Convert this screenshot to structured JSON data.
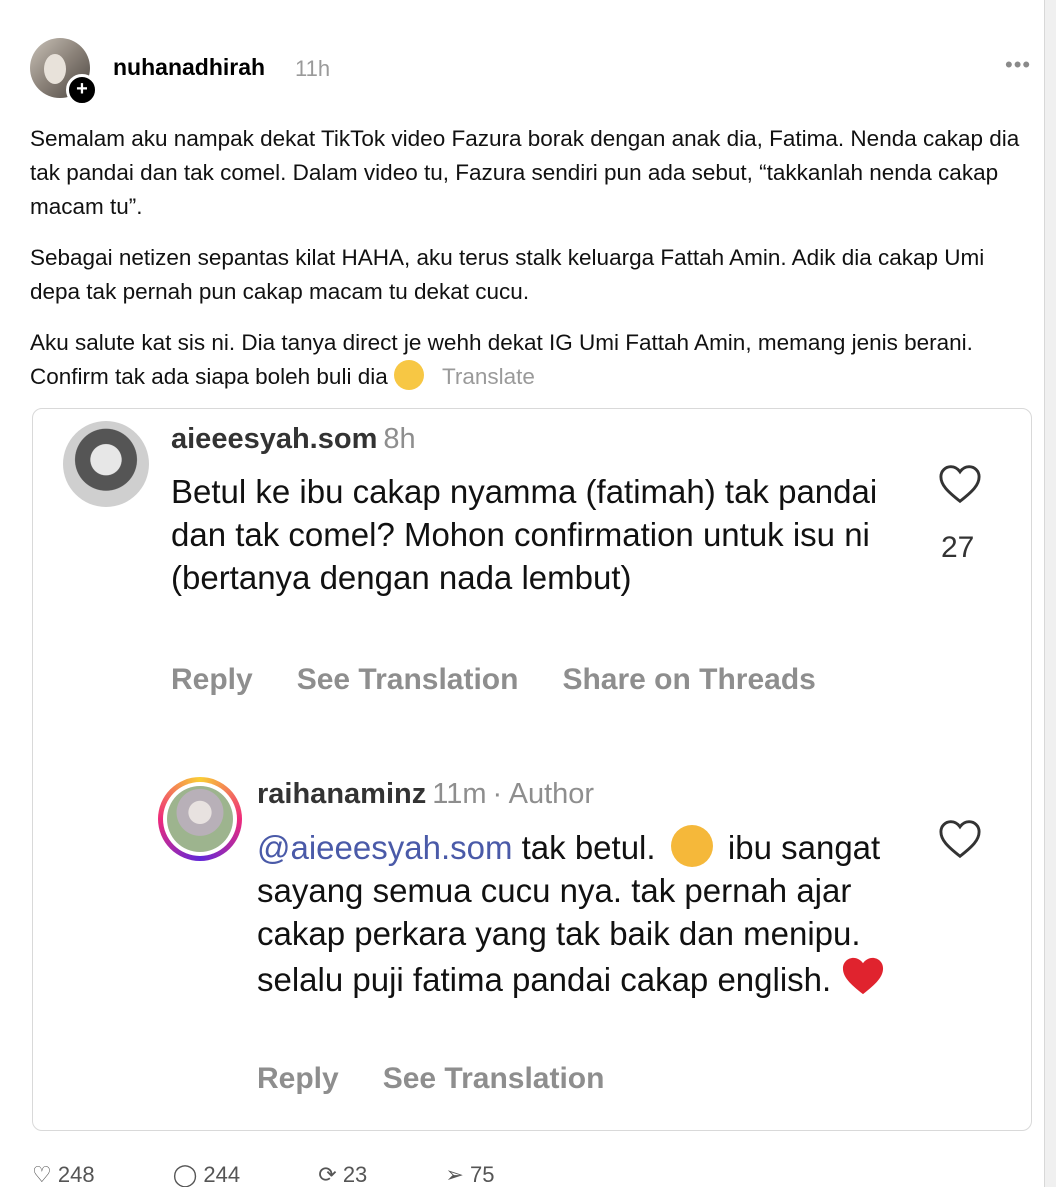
{
  "post": {
    "username": "nuhanadhirah",
    "time": "11h",
    "more": "•••",
    "paragraphs": [
      "Semalam aku nampak dekat TikTok video Fazura borak dengan anak dia, Fatima. Nenda cakap dia tak pandai dan tak comel. Dalam video tu, Fazura sendiri pun ada sebut, “takkanlah nenda cakap macam tu”.",
      "Sebagai netizen sepantas kilat HAHA, aku terus stalk keluarga Fattah Amin. Adik dia cakap Umi depa tak pernah pun cakap macam tu dekat cucu.",
      "Aku salute kat sis ni. Dia tanya direct je wehh dekat IG Umi Fattah Amin, memang jenis berani. Confirm tak ada siapa boleh buli dia"
    ],
    "translate": "Translate"
  },
  "comment1": {
    "username": "aieeesyah.som",
    "time": "8h",
    "text": "Betul ke ibu cakap nyamma (fatimah) tak pandai dan tak comel? Mohon confirmation untuk isu ni (bertanya dengan nada lembut)",
    "likes": "27",
    "actions": [
      "Reply",
      "See Translation",
      "Share on Threads"
    ]
  },
  "comment2": {
    "username": "raihanaminz",
    "time": "11m",
    "author_tag": "· Author",
    "mention": "@aieeesyah.som",
    "text_a": " tak betul. ",
    "text_b": " ibu sangat sayang semua cucu nya. tak pernah ajar cakap perkara yang tak baik dan menipu. selalu puji fatima pandai cakap english. ",
    "actions": [
      "Reply",
      "See Translation"
    ]
  },
  "footer": {
    "likes": "248",
    "comments": "244",
    "reposts": "23",
    "shares": "75"
  },
  "colors": {
    "mention": "#4a5aa8",
    "muted": "#8e8e8e"
  }
}
